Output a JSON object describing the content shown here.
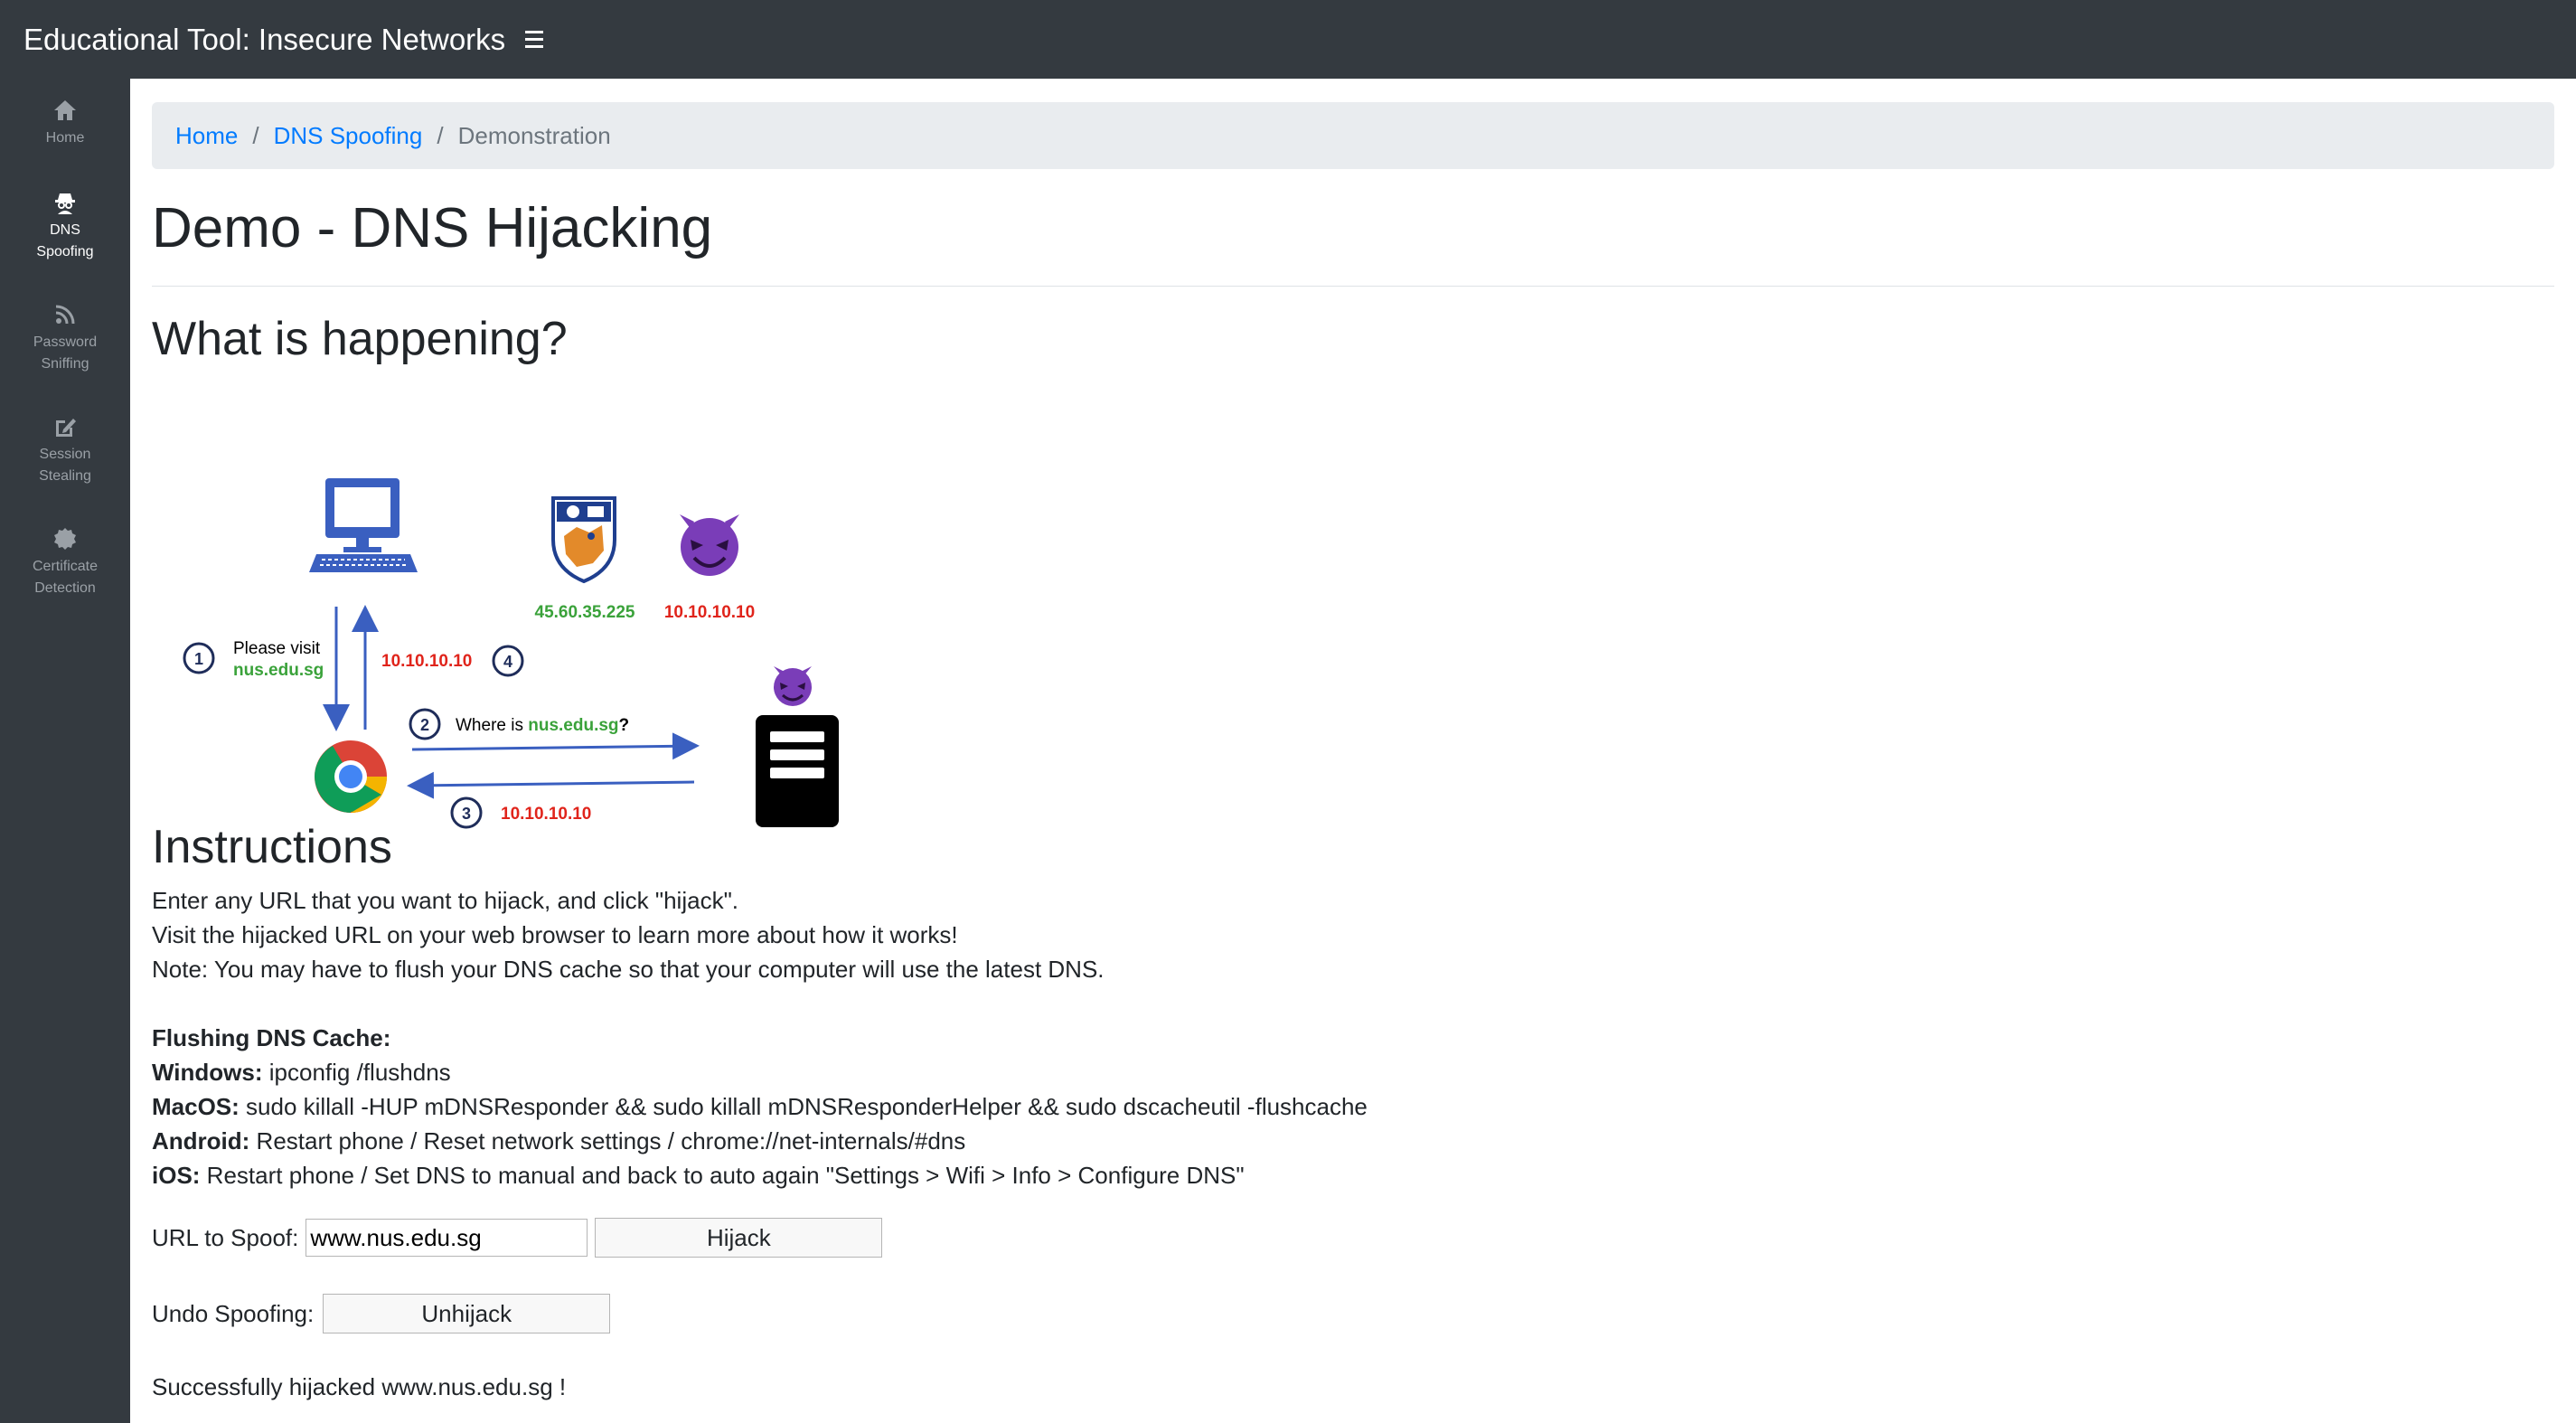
{
  "header": {
    "title": "Educational Tool: Insecure Networks"
  },
  "sidebar": {
    "items": [
      {
        "label_line1": "Home",
        "label_line2": "",
        "icon": "home-icon"
      },
      {
        "label_line1": "DNS",
        "label_line2": "Spoofing",
        "icon": "spy-icon"
      },
      {
        "label_line1": "Password",
        "label_line2": "Sniffing",
        "icon": "rss-icon"
      },
      {
        "label_line1": "Session",
        "label_line2": "Stealing",
        "icon": "edit-icon"
      },
      {
        "label_line1": "Certificate",
        "label_line2": "Detection",
        "icon": "cert-icon"
      }
    ]
  },
  "breadcrumb": {
    "items": [
      "Home",
      "DNS Spoofing",
      "Demonstration"
    ]
  },
  "page": {
    "title": "Demo - DNS Hijacking",
    "what_heading": "What is happening?",
    "instructions_heading": "Instructions"
  },
  "diagram": {
    "nus_ip": "45.60.35.225",
    "attacker_ip": "10.10.10.10",
    "step1_num": "1",
    "step1_text": "Please visit",
    "step1_domain": "nus.edu.sg",
    "step2_num": "2",
    "step2_text": "Where is ",
    "step2_domain": "nus.edu.sg",
    "step2_q": "?",
    "step3_num": "3",
    "step3_ip": "10.10.10.10",
    "step4_num": "4",
    "step4_ip": "10.10.10.10",
    "colors": {
      "blue": "#3a5fc0",
      "green": "#3aa23a",
      "red": "#e0241b",
      "devil": "#7a3db8"
    }
  },
  "instructions": {
    "line1": "Enter any URL that you want to hijack, and click \"hijack\".",
    "line2": "Visit the hijacked URL on your web browser to learn more about how it works!",
    "line3": "Note: You may have to flush your DNS cache so that your computer will use the latest DNS.",
    "flush_heading": "Flushing DNS Cache:",
    "windows_label": "Windows:",
    "windows_cmd": " ipconfig /flushdns",
    "macos_label": "MacOS:",
    "macos_cmd": " sudo killall -HUP mDNSResponder && sudo killall mDNSResponderHelper && sudo dscacheutil -flushcache",
    "android_label": "Android:",
    "android_cmd": " Restart phone / Reset network settings / chrome://net-internals/#dns",
    "ios_label": "iOS:",
    "ios_cmd": " Restart phone / Set DNS to manual and back to auto again \"Settings > Wifi > Info > Configure DNS\""
  },
  "form": {
    "url_label": "URL to Spoof:",
    "url_value": "www.nus.edu.sg",
    "hijack_label": "Hijack",
    "undo_label": "Undo Spoofing:",
    "unhijack_label": "Unhijack"
  },
  "status": {
    "message": "Successfully hijacked www.nus.edu.sg !"
  }
}
